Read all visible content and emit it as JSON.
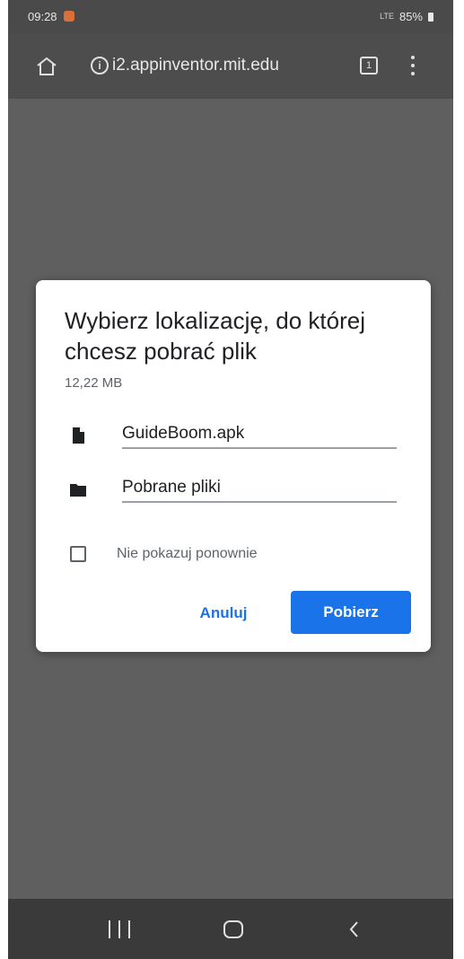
{
  "status_bar": {
    "time": "09:28",
    "network": "LTE",
    "battery": "85%"
  },
  "browser": {
    "url": "i2.appinventor.mit.edu",
    "tab_count": "1",
    "info_glyph": "i"
  },
  "dialog": {
    "title": "Wybierz lokalizację, do której chcesz pobrać plik",
    "file_size": "12,22 MB",
    "file_name": "GuideBoom.apk",
    "folder_name": "Pobrane pliki",
    "dont_show_label": "Nie pokazuj ponownie",
    "dont_show_checked": false,
    "cancel_label": "Anuluj",
    "download_label": "Pobierz"
  },
  "icons": {
    "home": "home-icon",
    "info": "info-icon",
    "tabs": "tab-switcher-icon",
    "menu": "more-vert-icon",
    "file": "file-icon",
    "folder": "folder-icon",
    "recent": "recent-apps-icon",
    "nav_home": "nav-home-icon",
    "back": "back-icon"
  },
  "colors": {
    "accent": "#1a73e8",
    "scrim": "#5f5f5f",
    "dialog_bg": "#ffffff"
  }
}
